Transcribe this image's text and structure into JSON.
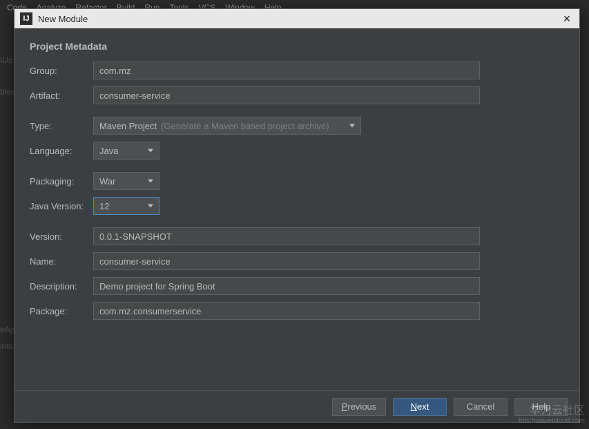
{
  "menubar": [
    "Code",
    "Analyze",
    "Refactor",
    "Build",
    "Run",
    "Tools",
    "VCS",
    "Window",
    "Help"
  ],
  "bg": {
    "us": "\\Us",
    "bles": "bles",
    "eap": "eAp",
    "ints": "ints"
  },
  "dialog": {
    "title": "New Module",
    "section_title": "Project Metadata",
    "fields": {
      "group_label": "Group:",
      "group_value": "com.mz",
      "artifact_label": "Artifact:",
      "artifact_value": "consumer-service",
      "type_label": "Type:",
      "type_value": "Maven Project",
      "type_hint": "(Generate a Maven based project archive)",
      "language_label": "Language:",
      "language_value": "Java",
      "packaging_label": "Packaging:",
      "packaging_value": "War",
      "javaver_label": "Java Version:",
      "javaver_value": "12",
      "version_label": "Version:",
      "version_value": "0.0.1-SNAPSHOT",
      "name_label": "Name:",
      "name_value": "consumer-service",
      "desc_label": "Description:",
      "desc_value": "Demo project for Spring Boot",
      "package_label": "Package:",
      "package_value": "com.mz.consumerservice"
    },
    "buttons": {
      "previous": "Previous",
      "next": "Next",
      "cancel": "Cancel",
      "help": "Help"
    }
  },
  "watermark": {
    "main": "华为云社区",
    "sub": "bbs.huaweicloud.com"
  }
}
